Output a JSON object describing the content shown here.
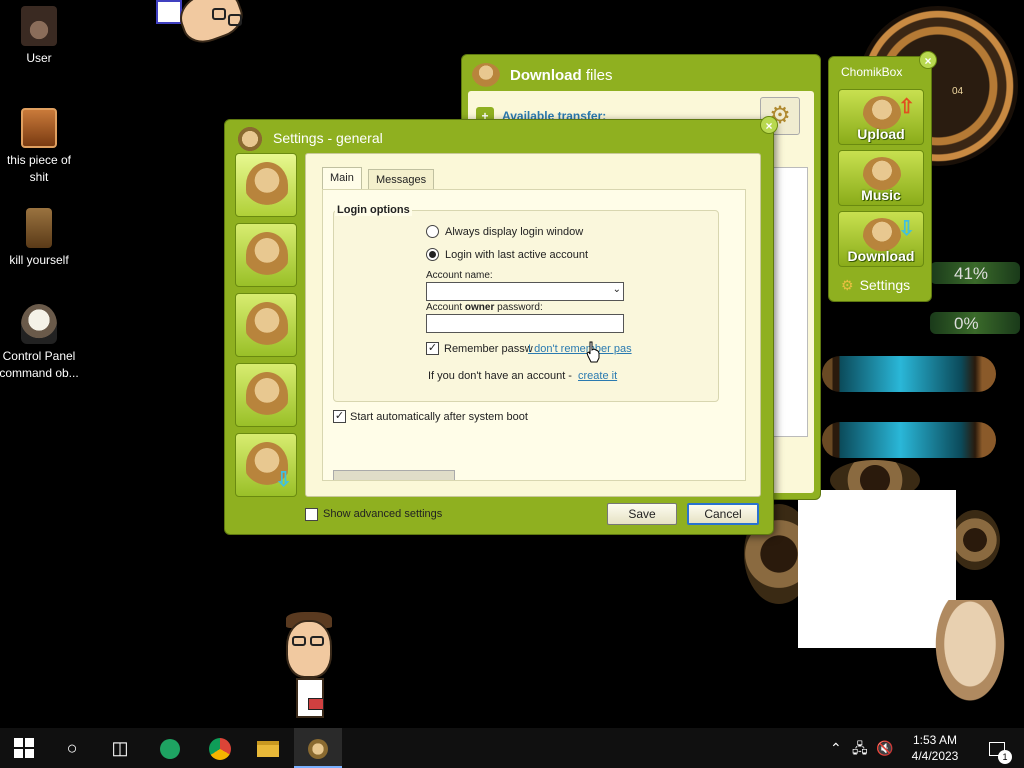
{
  "desktop": {
    "icons": [
      {
        "label": "User"
      },
      {
        "label": "this piece of shit"
      },
      {
        "label": "kill yourself"
      },
      {
        "label": "Control Panel command ob..."
      }
    ]
  },
  "download_window": {
    "title_bold": "Download",
    "title_rest": " files",
    "available_transfer": "Available transfer:"
  },
  "chomikbox": {
    "title": "ChomikBox",
    "buttons": [
      {
        "label": "Upload",
        "arrow_color": "#e05020"
      },
      {
        "label": "Music",
        "arrow_color": ""
      },
      {
        "label": "Download",
        "arrow_color": "#40c0e0"
      }
    ],
    "settings_label": "Settings"
  },
  "gauges": {
    "top_percent": "41%",
    "bottom_percent": "0%",
    "clock_number": "04"
  },
  "settings": {
    "title": "Settings - general",
    "tabs": [
      {
        "label": "Main",
        "active": true
      },
      {
        "label": "Messages",
        "active": false
      }
    ],
    "login_options": {
      "legend": "Login options",
      "option_always": "Always display login window",
      "option_last": "Login with last active account",
      "selected": "last",
      "account_name_label": "Account name:",
      "account_name_value": "",
      "password_label_pre": "Account ",
      "password_label_bold": "owner",
      "password_label_post": " password:",
      "password_value": "",
      "remember_label": "Remember passw",
      "remember_checked": true,
      "forgot_link": "I don't remember pas",
      "no_account_text": "If you don't have an account - ",
      "create_link": "create it"
    },
    "start_auto_label": "Start automatically after system boot",
    "start_auto_checked": true,
    "show_advanced_label": "Show advanced settings",
    "show_advanced_checked": false,
    "save_label": "Save",
    "cancel_label": "Cancel"
  },
  "taskbar": {
    "time": "1:53 AM",
    "date": "4/4/2023",
    "notification_count": "1"
  },
  "colors": {
    "window_green": "#8fb020",
    "content_cream": "#fbf8d8",
    "link_blue": "#2a7ab0",
    "taskbar": "#101010"
  }
}
